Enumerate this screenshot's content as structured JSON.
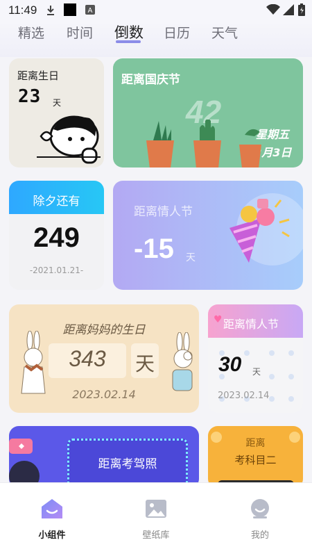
{
  "status_bar": {
    "time": "11:49"
  },
  "tabs": [
    {
      "label": "精选"
    },
    {
      "label": "时间"
    },
    {
      "label": "倒数"
    },
    {
      "label": "日历"
    },
    {
      "label": "天气"
    }
  ],
  "widgets": {
    "birthday": {
      "title": "距离生日",
      "number": "23",
      "unit": "天"
    },
    "national_day": {
      "title": "距离国庆节",
      "number": "42",
      "weekday": "星期五",
      "date": "02月3日"
    },
    "new_year_eve": {
      "title": "除夕还有",
      "number": "249",
      "date": "-2021.01.21-"
    },
    "valentine_big": {
      "title": "距离情人节",
      "number": "-15",
      "unit": "天"
    },
    "mom_birthday": {
      "title": "距离妈妈的生日",
      "number": "343",
      "unit": "天",
      "date": "2023.02.14"
    },
    "valentine_small": {
      "title": "距离情人节",
      "number": "30",
      "unit": "天",
      "date": "2023.02.14"
    },
    "driving_license": {
      "title": "距离考驾照"
    },
    "subject_two": {
      "title": "距离",
      "subtitle": "考科目二"
    }
  },
  "bottom_nav": [
    {
      "label": "小组件"
    },
    {
      "label": "壁纸库"
    },
    {
      "label": "我的"
    }
  ],
  "colors": {
    "accent": "#8b8ce8",
    "green": "#7cc39c",
    "blue": "#2ea8ff",
    "purple_grad": "#a5b4fb"
  }
}
